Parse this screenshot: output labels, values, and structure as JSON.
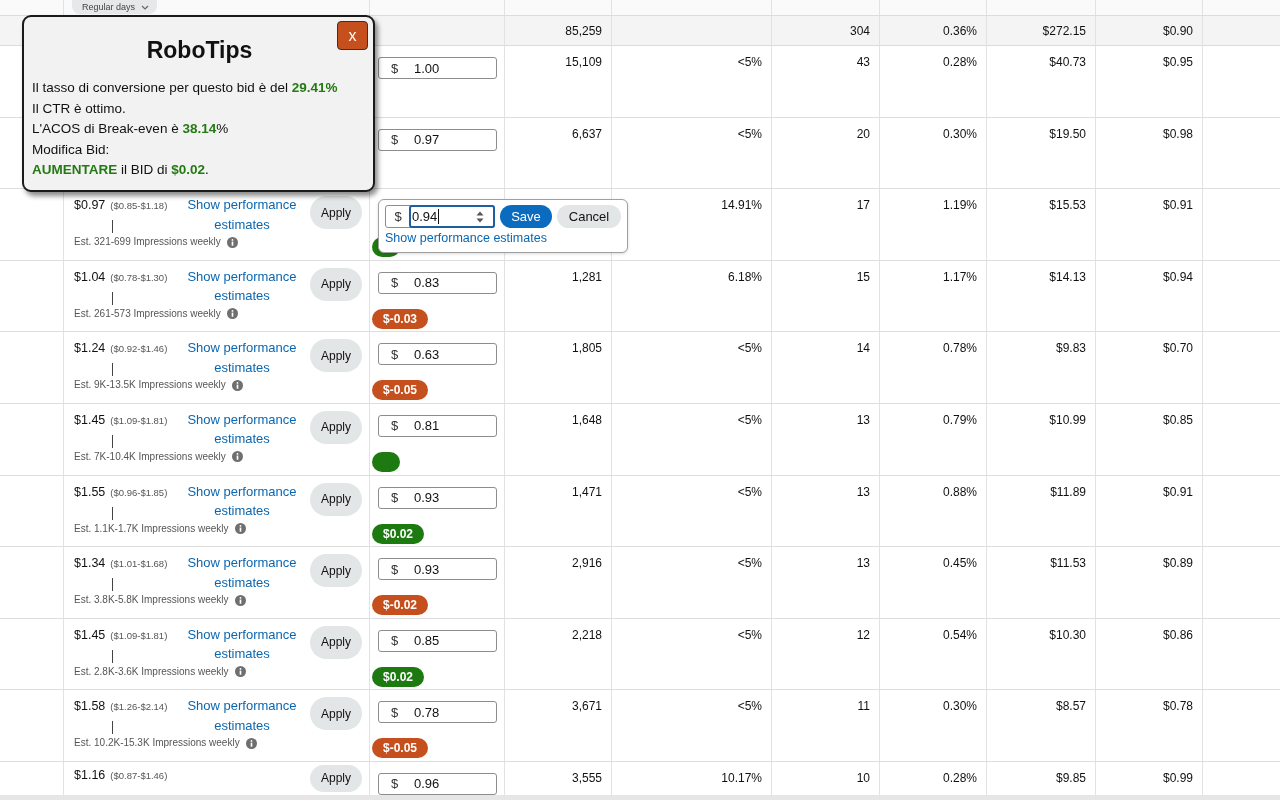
{
  "filter_chip": {
    "label": "Regular days"
  },
  "totals": {
    "column_4": "85,259",
    "column_6": "304",
    "column_7": "0.36%",
    "column_8": "$272.15",
    "column_9": "$0.90"
  },
  "rows": [
    {
      "bid": {
        "prefix": "$",
        "value": "1.00"
      },
      "cells": {
        "column_4": "15,109",
        "column_5": "<5%",
        "column_6": "43",
        "column_7": "0.28%",
        "column_8": "$40.73",
        "column_9": "$0.95"
      }
    },
    {
      "bid": {
        "prefix": "$",
        "value": "0.97"
      },
      "cells": {
        "column_4": "6,637",
        "column_5": "<5%",
        "column_6": "20",
        "column_7": "0.30%",
        "column_8": "$19.50",
        "column_9": "$0.98"
      }
    },
    {
      "suggestion": {
        "bid": "$0.97",
        "range": "($0.85-$1.18)",
        "link": "Show performance estimates",
        "apply": "Apply",
        "estimate": "Est. 321-699 Impressions weekly"
      },
      "bid_editor": {
        "prefix": "$",
        "value": "0.94",
        "save": "Save",
        "cancel": "Cancel",
        "link": "Show performance estimates"
      },
      "badge": {
        "color": "#1d7a10"
      },
      "cells": {
        "column_5": "14.91%",
        "column_6": "17",
        "column_7": "1.19%",
        "column_8": "$15.53",
        "column_9": "$0.91"
      }
    },
    {
      "suggestion": {
        "bid": "$1.04",
        "range": "($0.78-$1.30)",
        "link": "Show performance estimates",
        "apply": "Apply",
        "estimate": "Est. 261-573 Impressions weekly"
      },
      "bid": {
        "prefix": "$",
        "value": "0.83"
      },
      "badge": {
        "text": "$-0.03",
        "color": "#c6501d"
      },
      "cells": {
        "column_4": "1,281",
        "column_5": "6.18%",
        "column_6": "15",
        "column_7": "1.17%",
        "column_8": "$14.13",
        "column_9": "$0.94"
      }
    },
    {
      "suggestion": {
        "bid": "$1.24",
        "range": "($0.92-$1.46)",
        "link": "Show performance estimates",
        "apply": "Apply",
        "estimate": "Est. 9K-13.5K Impressions weekly"
      },
      "bid": {
        "prefix": "$",
        "value": "0.63"
      },
      "badge": {
        "text": "$-0.05",
        "color": "#c6501d"
      },
      "cells": {
        "column_4": "1,805",
        "column_5": "<5%",
        "column_6": "14",
        "column_7": "0.78%",
        "column_8": "$9.83",
        "column_9": "$0.70"
      }
    },
    {
      "suggestion": {
        "bid": "$1.45",
        "range": "($1.09-$1.81)",
        "link": "Show performance estimates",
        "apply": "Apply",
        "estimate": "Est. 7K-10.4K Impressions weekly"
      },
      "bid": {
        "prefix": "$",
        "value": "0.81"
      },
      "badge": {
        "color": "#1d7a10"
      },
      "cells": {
        "column_4": "1,648",
        "column_5": "<5%",
        "column_6": "13",
        "column_7": "0.79%",
        "column_8": "$10.99",
        "column_9": "$0.85"
      }
    },
    {
      "suggestion": {
        "bid": "$1.55",
        "range": "($0.96-$1.85)",
        "link": "Show performance estimates",
        "apply": "Apply",
        "estimate": "Est. 1.1K-1.7K Impressions weekly"
      },
      "bid": {
        "prefix": "$",
        "value": "0.93"
      },
      "badge": {
        "text": "$0.02",
        "color": "#1d7a10"
      },
      "cells": {
        "column_4": "1,471",
        "column_5": "<5%",
        "column_6": "13",
        "column_7": "0.88%",
        "column_8": "$11.89",
        "column_9": "$0.91"
      }
    },
    {
      "suggestion": {
        "bid": "$1.34",
        "range": "($1.01-$1.68)",
        "link": "Show performance estimates",
        "apply": "Apply",
        "estimate": "Est. 3.8K-5.8K Impressions weekly"
      },
      "bid": {
        "prefix": "$",
        "value": "0.93"
      },
      "badge": {
        "text": "$-0.02",
        "color": "#c6501d"
      },
      "cells": {
        "column_4": "2,916",
        "column_5": "<5%",
        "column_6": "13",
        "column_7": "0.45%",
        "column_8": "$11.53",
        "column_9": "$0.89"
      }
    },
    {
      "suggestion": {
        "bid": "$1.45",
        "range": "($1.09-$1.81)",
        "link": "Show performance estimates",
        "apply": "Apply",
        "estimate": "Est. 2.8K-3.6K Impressions weekly"
      },
      "bid": {
        "prefix": "$",
        "value": "0.85"
      },
      "badge": {
        "text": "$0.02",
        "color": "#1d7a10"
      },
      "cells": {
        "column_4": "2,218",
        "column_5": "<5%",
        "column_6": "12",
        "column_7": "0.54%",
        "column_8": "$10.30",
        "column_9": "$0.86"
      }
    },
    {
      "suggestion": {
        "bid": "$1.58",
        "range": "($1.26-$2.14)",
        "link": "Show performance estimates",
        "apply": "Apply",
        "estimate": "Est. 10.2K-15.3K Impressions weekly"
      },
      "bid": {
        "prefix": "$",
        "value": "0.78"
      },
      "badge": {
        "text": "$-0.05",
        "color": "#c6501d"
      },
      "cells": {
        "column_4": "3,671",
        "column_5": "<5%",
        "column_6": "11",
        "column_7": "0.30%",
        "column_8": "$8.57",
        "column_9": "$0.78"
      }
    },
    {
      "suggestion": {
        "bid": "$1.16",
        "range": "($0.87-$1.46)",
        "apply": "Apply"
      },
      "bid": {
        "prefix": "$",
        "value": "0.96"
      },
      "cells": {
        "column_4": "3,555",
        "column_5": "10.17%",
        "column_6": "10",
        "column_7": "0.28%",
        "column_8": "$9.85",
        "column_9": "$0.99"
      }
    }
  ],
  "robotips": {
    "title": "RoboTips",
    "close": "x",
    "lines": [
      "Il tasso di conversione per questo bid è del **29.41%**",
      "Il CTR è ottimo.",
      "L'ACOS di Break-even è **38.14**%",
      "Modifica Bid:",
      "**AUMENTARE** il BID di **$0.02**."
    ]
  }
}
